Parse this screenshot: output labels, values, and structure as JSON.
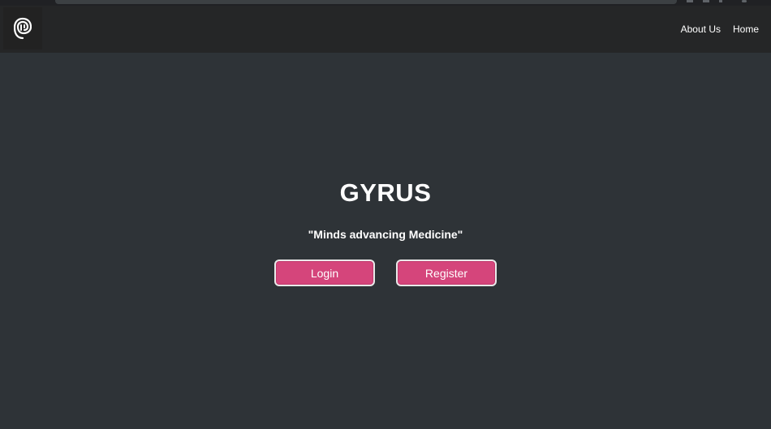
{
  "navbar": {
    "logo_icon": "brain-spiral-logo-icon",
    "links": [
      {
        "label": "About Us"
      },
      {
        "label": "Home"
      }
    ]
  },
  "hero": {
    "title": "GYRUS",
    "tagline": "\"Minds advancing Medicine\"",
    "login_label": "Login",
    "register_label": "Register"
  },
  "colors": {
    "background": "#2e3337",
    "navbar": "#252627",
    "button": "#d5457b",
    "text": "#ffffff"
  }
}
